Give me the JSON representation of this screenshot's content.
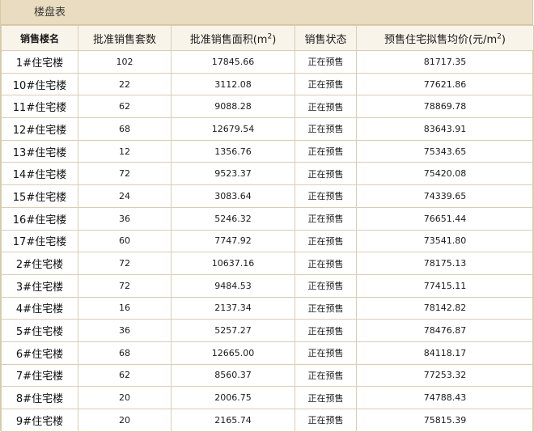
{
  "panel": {
    "title": "楼盘表"
  },
  "table": {
    "headers": {
      "building": "销售楼名",
      "units": "批准销售套数",
      "area_prefix": "批准销售面积(m",
      "area_sup": "2",
      "area_suffix": ")",
      "status": "销售状态",
      "price_prefix": "预售住宅拟售均价(元/m",
      "price_sup": "2",
      "price_suffix": ")"
    },
    "rows": [
      {
        "building": "1#住宅楼",
        "units": "102",
        "area": "17845.66",
        "status": "正在预售",
        "price": "81717.35"
      },
      {
        "building": "10#住宅楼",
        "units": "22",
        "area": "3112.08",
        "status": "正在预售",
        "price": "77621.86"
      },
      {
        "building": "11#住宅楼",
        "units": "62",
        "area": "9088.28",
        "status": "正在预售",
        "price": "78869.78"
      },
      {
        "building": "12#住宅楼",
        "units": "68",
        "area": "12679.54",
        "status": "正在预售",
        "price": "83643.91"
      },
      {
        "building": "13#住宅楼",
        "units": "12",
        "area": "1356.76",
        "status": "正在预售",
        "price": "75343.65"
      },
      {
        "building": "14#住宅楼",
        "units": "72",
        "area": "9523.37",
        "status": "正在预售",
        "price": "75420.08"
      },
      {
        "building": "15#住宅楼",
        "units": "24",
        "area": "3083.64",
        "status": "正在预售",
        "price": "74339.65"
      },
      {
        "building": "16#住宅楼",
        "units": "36",
        "area": "5246.32",
        "status": "正在预售",
        "price": "76651.44"
      },
      {
        "building": "17#住宅楼",
        "units": "60",
        "area": "7747.92",
        "status": "正在预售",
        "price": "73541.80"
      },
      {
        "building": "2#住宅楼",
        "units": "72",
        "area": "10637.16",
        "status": "正在预售",
        "price": "78175.13"
      },
      {
        "building": "3#住宅楼",
        "units": "72",
        "area": "9484.53",
        "status": "正在预售",
        "price": "77415.11"
      },
      {
        "building": "4#住宅楼",
        "units": "16",
        "area": "2137.34",
        "status": "正在预售",
        "price": "78142.82"
      },
      {
        "building": "5#住宅楼",
        "units": "36",
        "area": "5257.27",
        "status": "正在预售",
        "price": "78476.87"
      },
      {
        "building": "6#住宅楼",
        "units": "68",
        "area": "12665.00",
        "status": "正在预售",
        "price": "84118.17"
      },
      {
        "building": "7#住宅楼",
        "units": "62",
        "area": "8560.37",
        "status": "正在预售",
        "price": "77253.32"
      },
      {
        "building": "8#住宅楼",
        "units": "20",
        "area": "2006.75",
        "status": "正在预售",
        "price": "74788.43"
      },
      {
        "building": "9#住宅楼",
        "units": "20",
        "area": "2165.74",
        "status": "正在预售",
        "price": "75815.39"
      }
    ]
  },
  "colors": {
    "header_band": "#e9dcc0",
    "column_header_bg": "#f9f4ea",
    "grid_line": "#d9cdb5"
  }
}
